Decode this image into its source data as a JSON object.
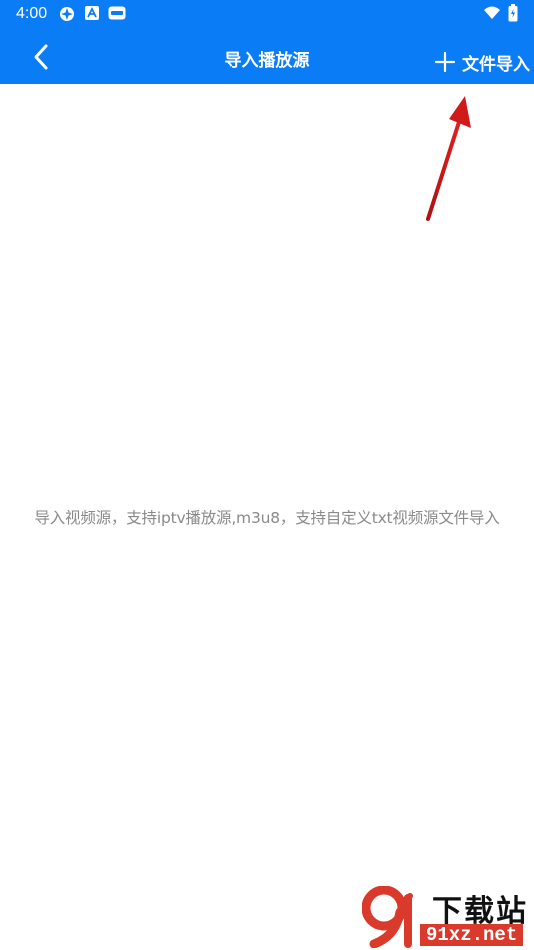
{
  "status_bar": {
    "time": "4:00",
    "icons": [
      "spark-icon",
      "a-badge-icon",
      "notification-badge-icon",
      "wifi-icon",
      "battery-icon"
    ]
  },
  "app_bar": {
    "title": "导入播放源",
    "back_icon": "chevron-left-icon",
    "import_action": {
      "icon": "plus-icon",
      "label": "文件导入"
    }
  },
  "main": {
    "empty_message": "导入视频源，支持iptv播放源,m3u8，支持自定义txt视频源文件导入"
  },
  "annotation": {
    "icon": "red-arrow-icon",
    "color": "#d11a1a"
  },
  "watermark": {
    "title": "下载站",
    "url": "91xz.net",
    "logo_icon": "91-logo-icon"
  },
  "colors": {
    "app_bar": "#0a7cf6",
    "message_text": "#8a8a8a",
    "watermark_red": "#d93a2b"
  }
}
